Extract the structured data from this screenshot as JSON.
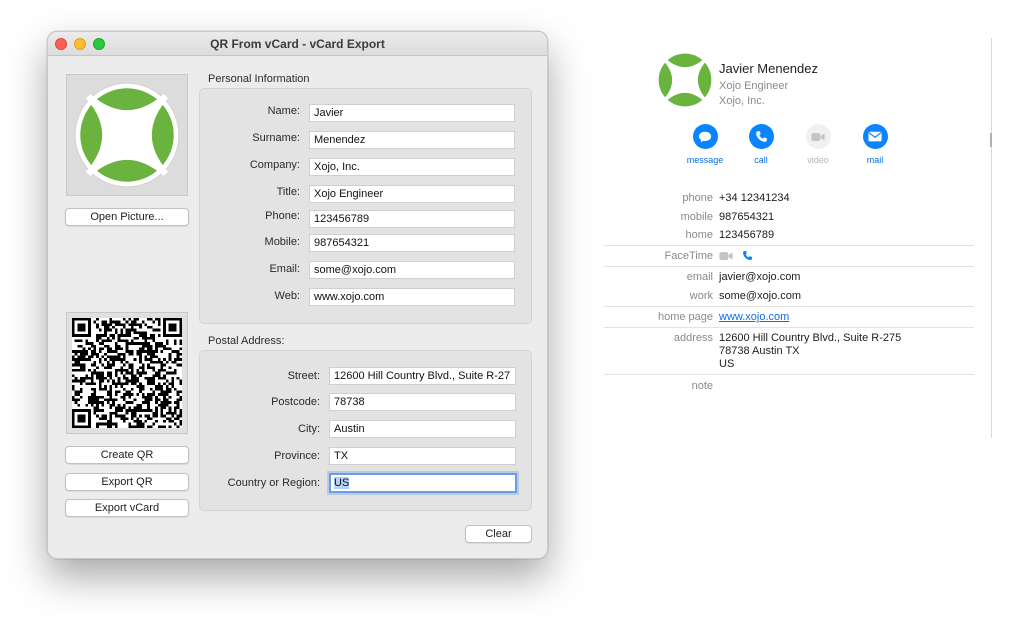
{
  "window": {
    "title": "QR From vCard - vCard Export"
  },
  "left_panel": {
    "open_picture_label": "Open Picture...",
    "create_qr_label": "Create QR",
    "export_qr_label": "Export QR",
    "export_vcard_label": "Export vCard"
  },
  "personal": {
    "section_title": "Personal Information",
    "fields": [
      {
        "label": "Name:",
        "value": "Javier"
      },
      {
        "label": "Surname:",
        "value": "Menendez"
      },
      {
        "label": "Company:",
        "value": "Xojo, Inc."
      },
      {
        "label": "Title:",
        "value": "Xojo Engineer"
      },
      {
        "label": "Phone:",
        "value": "123456789"
      },
      {
        "label": "Mobile:",
        "value": "987654321"
      },
      {
        "label": "Email:",
        "value": "some@xojo.com"
      },
      {
        "label": "Web:",
        "value": "www.xojo.com"
      }
    ]
  },
  "postal": {
    "section_title": "Postal Address:",
    "fields": [
      {
        "label": "Street:",
        "value": "12600 Hill Country Blvd., Suite R-27"
      },
      {
        "label": "Postcode:",
        "value": "78738"
      },
      {
        "label": "City:",
        "value": "Austin"
      },
      {
        "label": "Province:",
        "value": "TX"
      },
      {
        "label": "Country or Region:",
        "value": "US"
      }
    ]
  },
  "clear_label": "Clear",
  "card": {
    "name": "Javier Menendez",
    "job_title": "Xojo Engineer",
    "company": "Xojo, Inc.",
    "actions": [
      {
        "label": "message",
        "icon": "message-icon",
        "enabled": true
      },
      {
        "label": "call",
        "icon": "phone-icon",
        "enabled": true
      },
      {
        "label": "video",
        "icon": "video-icon",
        "enabled": false
      },
      {
        "label": "mail",
        "icon": "mail-icon",
        "enabled": true
      }
    ],
    "rows": [
      {
        "key": "phone",
        "value": "+34 12341234"
      },
      {
        "key": "mobile",
        "value": "987654321"
      },
      {
        "key": "home",
        "value": "123456789"
      },
      {
        "key": "FaceTime",
        "value": ""
      },
      {
        "key": "email",
        "value": "javier@xojo.com"
      },
      {
        "key": "work",
        "value": "some@xojo.com"
      },
      {
        "key": "home page",
        "value": "www.xojo.com"
      },
      {
        "key": "address",
        "lines": [
          "12600 Hill Country Blvd., Suite R-275",
          "78738 Austin TX",
          "US"
        ]
      },
      {
        "key": "note",
        "value": ""
      }
    ]
  },
  "colors": {
    "accent": "#0a84ff",
    "logo_green": "#6bb33f",
    "focus_ring": "#6b9ce8"
  }
}
